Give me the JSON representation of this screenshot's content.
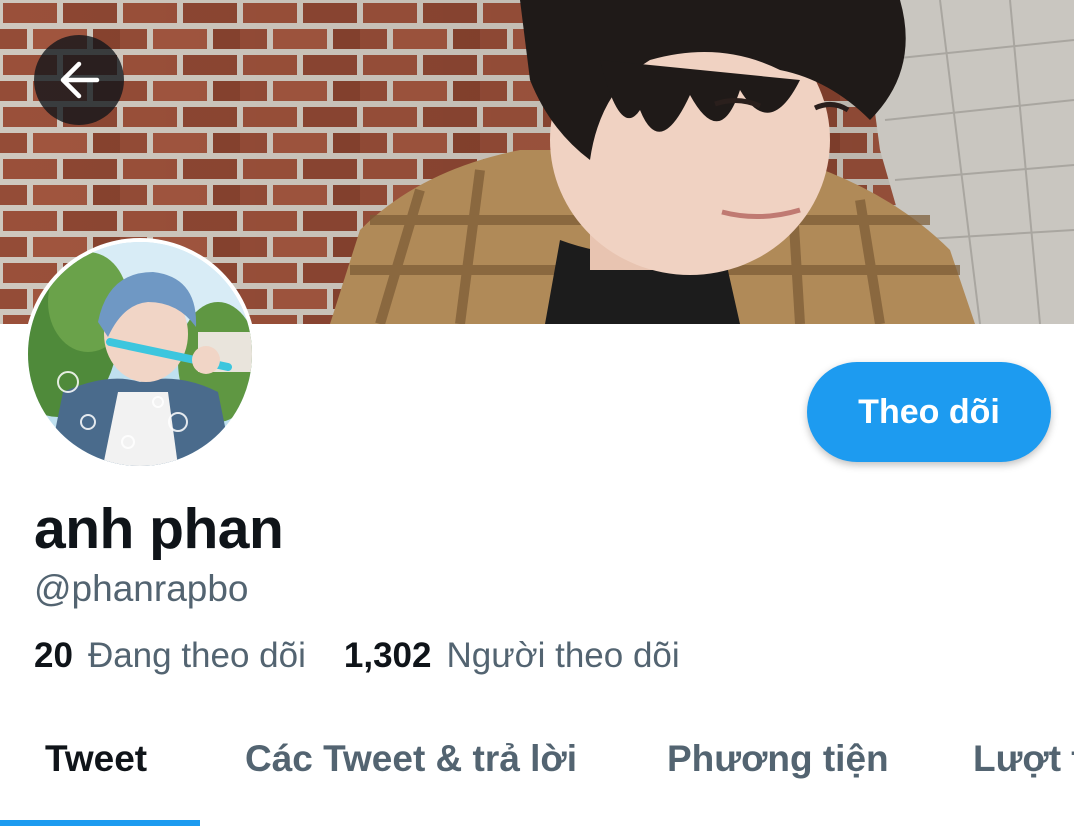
{
  "profile": {
    "display_name": "anh phan",
    "handle": "@phanrapbo",
    "following_count": "20",
    "following_label": "Đang theo dõi",
    "followers_count": "1,302",
    "followers_label": "Người theo dõi"
  },
  "actions": {
    "follow_label": "Theo dõi",
    "back_icon": "arrow-left-icon"
  },
  "tabs": [
    {
      "label": "Tweet",
      "active": true
    },
    {
      "label": "Các Tweet & trả lời",
      "active": false
    },
    {
      "label": "Phương tiện",
      "active": false
    },
    {
      "label": "Lượt thích",
      "active": false
    }
  ],
  "colors": {
    "accent": "#1d9bf0",
    "primary_text": "#0f1419",
    "secondary_text": "#536471"
  }
}
